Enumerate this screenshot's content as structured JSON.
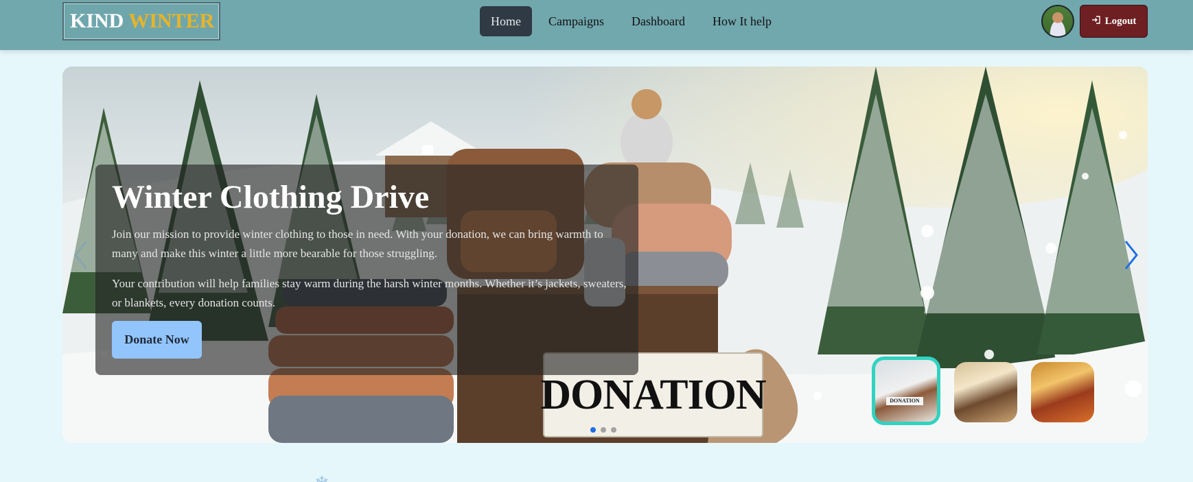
{
  "brand": {
    "part1": "KIND",
    "part2": "WINTER"
  },
  "nav": {
    "items": [
      {
        "label": "Home",
        "active": true
      },
      {
        "label": "Campaigns",
        "active": false
      },
      {
        "label": "Dashboard",
        "active": false
      },
      {
        "label": "How It help",
        "active": false
      }
    ]
  },
  "user": {
    "logout_label": "Logout",
    "logout_icon": "logout-icon",
    "avatar_icon": "user-avatar"
  },
  "hero": {
    "title": "Winter Clothing Drive",
    "paragraph1": "Join our mission to provide winter clothing to those in need. With your donation, we can bring warmth to many and make this winter a little more bearable for those struggling.",
    "paragraph2": "Your contribution will help families stay warm during the harsh winter months. Whether it’s jackets, sweaters, or blankets, every donation counts.",
    "cta_label": "Donate Now",
    "sign_text": "DONATION",
    "thumb_sign_text": "DONATION",
    "slides_count": 3,
    "active_slide": 1
  },
  "colors": {
    "navbar": "#71a8ae",
    "brand_accent": "#e7b42a",
    "logout": "#6e1f22",
    "cta": "#93c5fd",
    "active_dot": "#1f6fe5",
    "thumb_active_border": "#2fd3c0"
  }
}
